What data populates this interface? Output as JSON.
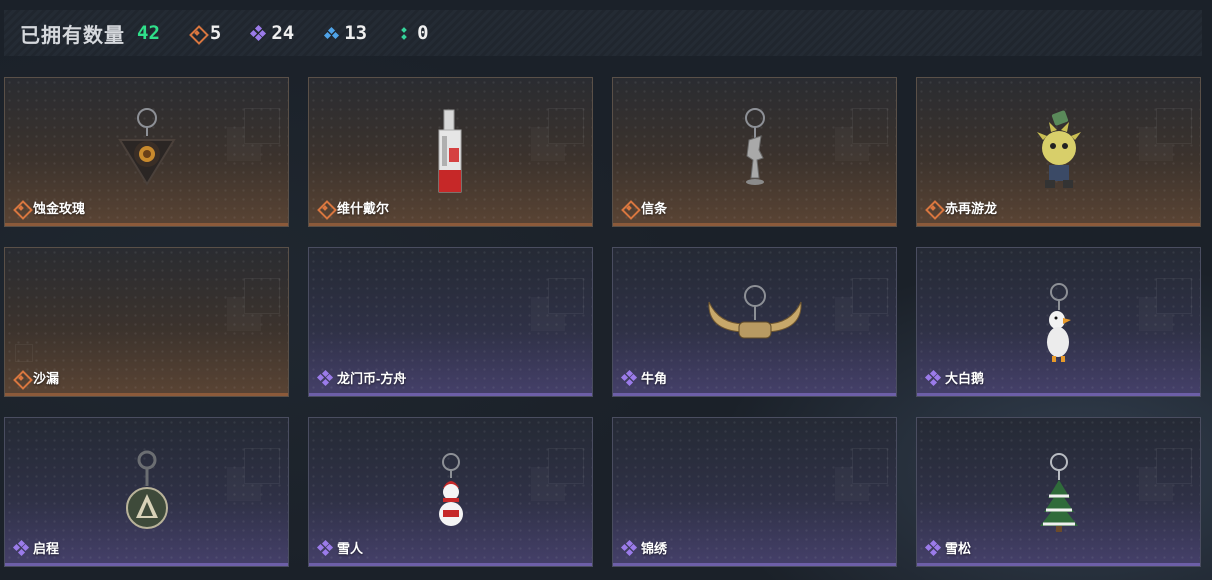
{
  "header": {
    "title": "已拥有数量",
    "total": "42",
    "stats": [
      {
        "rarity": "orange",
        "icon": "orange-diamond-icon",
        "count": "5",
        "color": "#d9763f"
      },
      {
        "rarity": "purple",
        "icon": "purple-diamond-icon",
        "count": "24",
        "color": "#9b7bea"
      },
      {
        "rarity": "blue",
        "icon": "blue-diamond-icon",
        "count": "13",
        "color": "#4fa3e8"
      },
      {
        "rarity": "green",
        "icon": "green-diamond-icon",
        "count": "0",
        "color": "#34d39a"
      }
    ]
  },
  "items": [
    {
      "name": "蚀金玫瑰",
      "rarity": "orange",
      "charm": "dark-rose"
    },
    {
      "name": "维什戴尔",
      "rarity": "orange",
      "charm": "red-card"
    },
    {
      "name": "信条",
      "rarity": "orange",
      "charm": "silver-figure"
    },
    {
      "name": "赤再游龙",
      "rarity": "orange",
      "charm": "yellow-dragon"
    },
    {
      "name": "沙漏",
      "rarity": "orange",
      "charm": "none"
    },
    {
      "name": "龙门币-方舟",
      "rarity": "purple",
      "charm": "none"
    },
    {
      "name": "牛角",
      "rarity": "purple",
      "charm": "horns"
    },
    {
      "name": "大白鹅",
      "rarity": "purple",
      "charm": "goose"
    },
    {
      "name": "启程",
      "rarity": "purple",
      "charm": "medal"
    },
    {
      "name": "雪人",
      "rarity": "purple",
      "charm": "snowman"
    },
    {
      "name": "锦绣",
      "rarity": "purple",
      "charm": "none"
    },
    {
      "name": "雪松",
      "rarity": "purple",
      "charm": "snowy-tree"
    }
  ]
}
